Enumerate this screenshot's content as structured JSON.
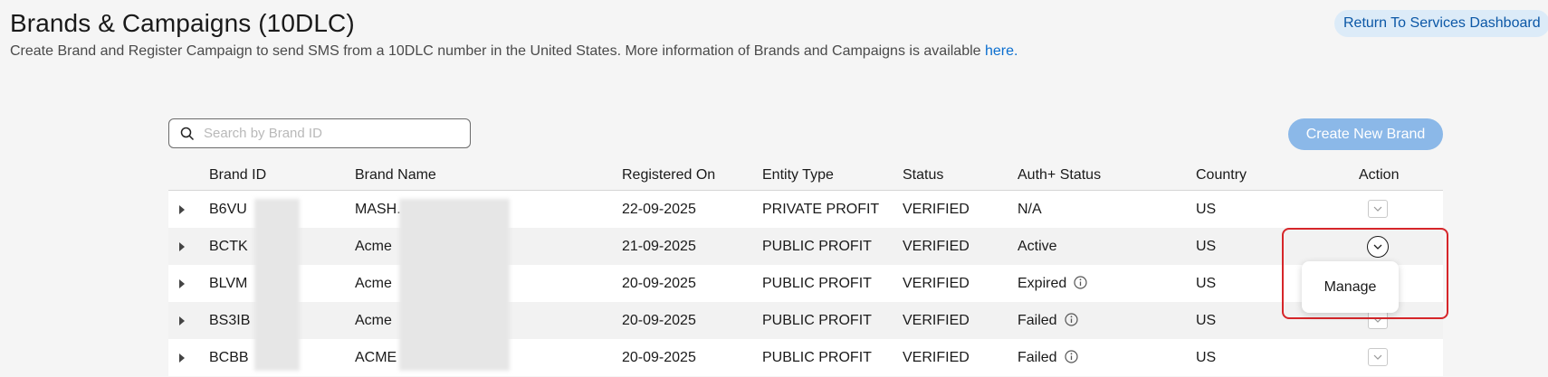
{
  "header": {
    "title": "Brands & Campaigns (10DLC)",
    "subtitle": "Create Brand and Register Campaign to send SMS from a 10DLC number in the United States. More information of Brands and Campaigns is available ",
    "subtitle_link": "here.",
    "return_label": "Return To Services Dashboard"
  },
  "search": {
    "placeholder": "Search by Brand ID",
    "value": ""
  },
  "create_label": "Create New Brand",
  "table": {
    "columns": [
      "Brand ID",
      "Brand Name",
      "Registered On",
      "Entity Type",
      "Status",
      "Auth+ Status",
      "Country",
      "Action"
    ],
    "rows": [
      {
        "brand_id": "B6VU",
        "brand_name": "MASH.",
        "registered_on": "22-09-2025",
        "entity_type": "PRIVATE PROFIT",
        "status": "VERIFIED",
        "auth_status": "N/A",
        "country": "US"
      },
      {
        "brand_id": "BCTK",
        "brand_name": "Acme",
        "registered_on": "21-09-2025",
        "entity_type": "PUBLIC PROFIT",
        "status": "VERIFIED",
        "auth_status": "Active",
        "country": "US"
      },
      {
        "brand_id": "BLVM",
        "brand_name": "Acme",
        "registered_on": "20-09-2025",
        "entity_type": "PUBLIC PROFIT",
        "status": "VERIFIED",
        "auth_status": "Expired",
        "country": "US"
      },
      {
        "brand_id": "BS3IB",
        "brand_name": "Acme",
        "registered_on": "20-09-2025",
        "entity_type": "PUBLIC PROFIT",
        "status": "VERIFIED",
        "auth_status": "Failed",
        "country": "US"
      },
      {
        "brand_id": "BCBB",
        "brand_name": "ACME",
        "registered_on": "20-09-2025",
        "entity_type": "PUBLIC PROFIT",
        "status": "VERIFIED",
        "auth_status": "Failed",
        "country": "US"
      }
    ]
  },
  "action_menu": {
    "item_label": "Manage"
  },
  "colors": {
    "accent": "#0b6ecf",
    "create_button": "#8bb8e8",
    "highlight": "#d6262a"
  },
  "icons": {
    "search": "search-icon",
    "expand": "chevron-right-icon",
    "info": "info-icon",
    "action": "chevron-down-icon"
  }
}
